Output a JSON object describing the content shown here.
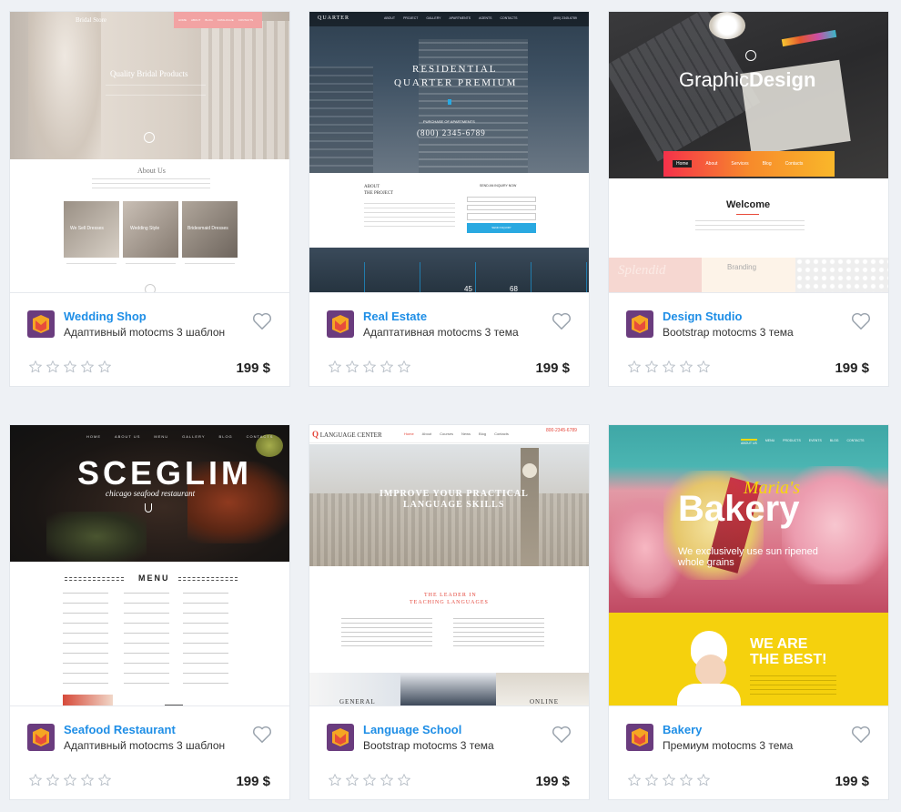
{
  "cards": [
    {
      "title": "Wedding Shop",
      "subtitle": "Адаптивный motocms 3 шаблон",
      "price": "199 $",
      "rating": 0,
      "preview": {
        "brand": "Bridal Store",
        "nav": [
          "HOME",
          "ABOUT",
          "BLOG",
          "CATALOGUE",
          "CONTACTS"
        ],
        "hero_title": "Quality Bridal Products",
        "section_title": "About Us",
        "tiles": [
          "We Sell Dresses",
          "Wedding Style",
          "Bridesmaid Dresses"
        ]
      }
    },
    {
      "title": "Real Estate",
      "subtitle": "Адаптативная motocms 3 тема",
      "price": "199 $",
      "rating": 0,
      "preview": {
        "brand": "QUARTER",
        "nav": [
          "ABOUT",
          "PROJECT",
          "GALLERY",
          "APARTMENTS",
          "AGENTS",
          "CONTACTS"
        ],
        "phone_top": "(800) 2345-6789",
        "hero_line1": "RESIDENTIAL",
        "hero_line2": "QUARTER PREMIUM",
        "hero_small": "PURCHASE OF APARTMENTS",
        "hero_phone": "(800) 2345-6789",
        "about_label1": "ABOUT",
        "about_label2": "THE PROJECT",
        "form_title": "SEND AN INQUIRY NOW",
        "form_button": "SEND INQUIRY",
        "stats": [
          "45",
          "68"
        ]
      }
    },
    {
      "title": "Design Studio",
      "subtitle": "Bootstrap motocms 3 тема",
      "price": "199 $",
      "rating": 0,
      "preview": {
        "hero_light": "Graphic",
        "hero_bold": "Design",
        "nav": [
          "Home",
          "About",
          "Services",
          "Blog",
          "Contacts"
        ],
        "section_title": "Welcome",
        "strip": [
          "Splendid",
          "Branding"
        ]
      }
    },
    {
      "title": "Seafood Restaurant",
      "subtitle": "Адаптивный motocms 3 шаблон",
      "price": "199 $",
      "rating": 0,
      "preview": {
        "nav": [
          "HOME",
          "ABOUT US",
          "MENU",
          "GALLERY",
          "BLOG",
          "CONTACTS"
        ],
        "hero_title": "SCEGLIM",
        "hero_sub": "chicago seafood restaurant",
        "menu_title": "MENU"
      }
    },
    {
      "title": "Language School",
      "subtitle": "Bootstrap motocms 3 тема",
      "price": "199 $",
      "rating": 0,
      "preview": {
        "brand_q": "Q",
        "brand": "LANGUAGE CENTER",
        "nav": [
          "Home",
          "About",
          "Courses",
          "News",
          "Blog",
          "Contacts"
        ],
        "phone": "800-2345-6789",
        "hero_line1": "IMPROVE YOUR PRACTICAL",
        "hero_line2": "LANGUAGE SKILLS",
        "section_line1": "THE LEADER IN",
        "section_line2": "TEACHING LANGUAGES",
        "label_left": "GENERAL",
        "label_right": "ONLINE"
      }
    },
    {
      "title": "Bakery",
      "subtitle": "Премиум motocms 3 тема",
      "price": "199 $",
      "rating": 0,
      "preview": {
        "nav": [
          "ABOUT US",
          "MENU",
          "PRODUCTS",
          "EVENTS",
          "BLOG",
          "CONTACTS"
        ],
        "script": "Maria's",
        "hero_title": "Bakery",
        "tagline": "We exclusively use sun ripened whole grains",
        "promo_line1": "WE ARE",
        "promo_line2": "THE BEST!"
      }
    }
  ]
}
